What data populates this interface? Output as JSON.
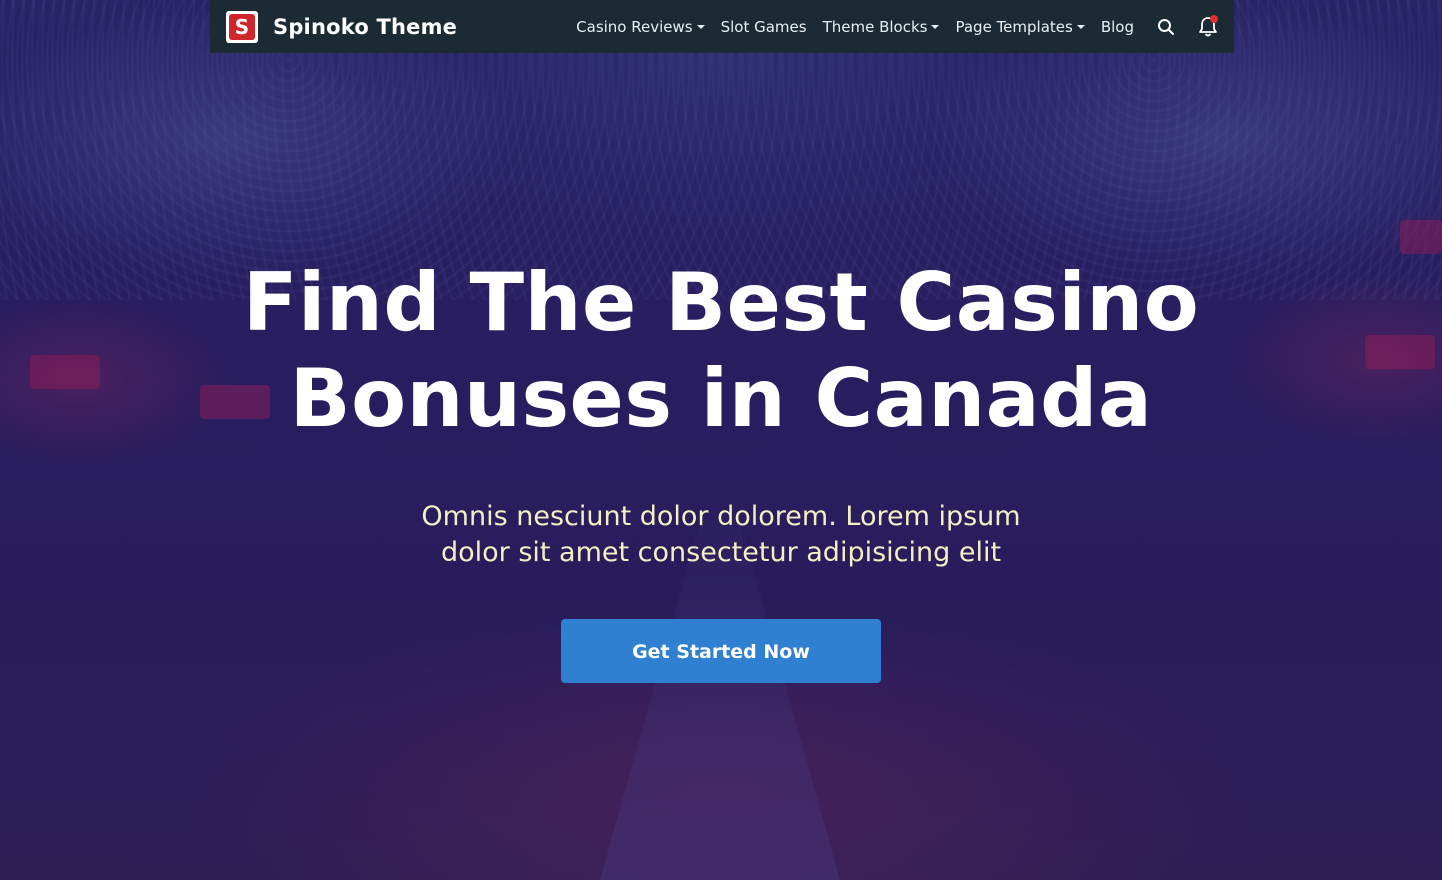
{
  "navbar": {
    "brand_logo_letter": "S",
    "brand_name": "Spinoko Theme",
    "items": [
      {
        "label": "Casino Reviews",
        "has_dropdown": true
      },
      {
        "label": "Slot Games",
        "has_dropdown": false
      },
      {
        "label": "Theme Blocks",
        "has_dropdown": true
      },
      {
        "label": "Page Templates",
        "has_dropdown": true
      },
      {
        "label": "Blog",
        "has_dropdown": false
      }
    ],
    "icons": [
      "search-icon",
      "bell-icon"
    ]
  },
  "hero": {
    "title_line1": "Find The Best Casino",
    "title_line2": "Bonuses in Canada",
    "subtitle": "Omnis nesciunt dolor dolorem. Lorem ipsum dolor sit amet consectetur adipisicing elit",
    "cta_label": "Get Started Now"
  },
  "colors": {
    "navbar_bg": "#1c2b33",
    "brand_red": "#d0262b",
    "cta_blue": "#2f80d0",
    "subtitle": "#f2f0c2",
    "notification_dot": "#e0302f"
  }
}
